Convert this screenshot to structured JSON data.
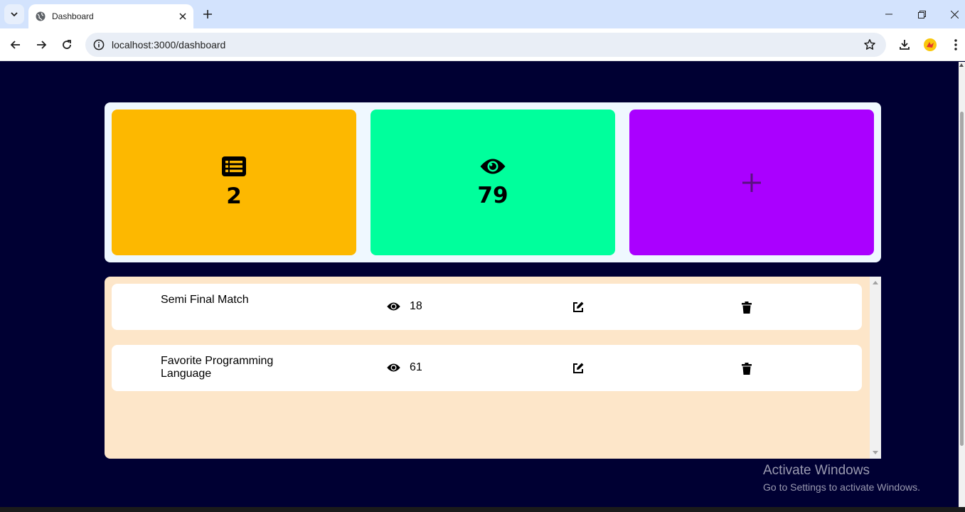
{
  "browser": {
    "tab_title": "Dashboard",
    "url": "localhost:3000/dashboard"
  },
  "stats": {
    "polls_count": "2",
    "views_total": "79",
    "colors": {
      "polls": "#fdb800",
      "views": "#00ff9c",
      "add": "#aa00ff"
    },
    "icons": {
      "polls": "list-icon",
      "views": "eye-icon",
      "add": "plus-icon"
    }
  },
  "polls": [
    {
      "title": "Semi Final Match",
      "views": "18"
    },
    {
      "title": "Favorite Programming Language",
      "views": "61"
    }
  ],
  "watermark": {
    "line1": "Activate Windows",
    "line2": "Go to Settings to activate Windows."
  }
}
